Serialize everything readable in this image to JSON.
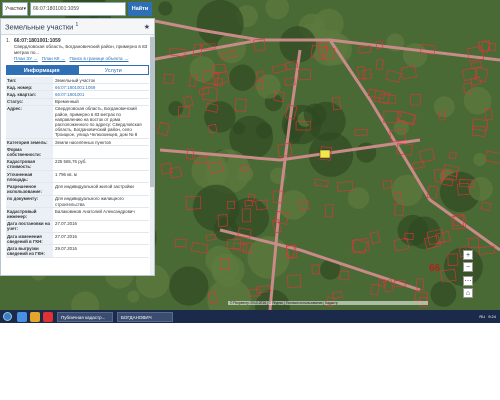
{
  "search": {
    "layer": "Участки",
    "value": "66:07:1801001:1059",
    "button": "Найти"
  },
  "panel": {
    "title": "Земельные участки",
    "title_count": "1",
    "result": {
      "index": "1.",
      "number": "66:07:1801001:1059",
      "address": "Свердловская область, Богдановичский район, примерно в 83 метрах по..."
    },
    "links": [
      "План ЗУ →",
      "План КК →",
      "Поиск в границе объекта →"
    ],
    "tabs": [
      {
        "label": "Информация"
      },
      {
        "label": "Услуги"
      }
    ],
    "props": [
      {
        "k": "Тип:",
        "v": "Земельный участок"
      },
      {
        "k": "Кад. номер:",
        "v": "66:07:1801001:1059"
      },
      {
        "k": "Кад. квартал:",
        "v": "66:07:1801001"
      },
      {
        "k": "Статус:",
        "v": "Временный"
      },
      {
        "k": "Адрес:",
        "v": "Свердловская область, Богдановичский район, примерно в 83 метрах по направлению на восток от дома расположенного по адресу: Свердловская область, Богдановичский район, село Троицкое, улица Челюскинцев, дом № 8"
      },
      {
        "k": "Категория земель:",
        "v": "Земли населённых пунктов"
      },
      {
        "k": "Форма собственности:",
        "v": ""
      },
      {
        "k": "Кадастровая стоимость:",
        "v": "225 565,76 руб."
      },
      {
        "k": "Уточненная площадь:",
        "v": "1 796 кв. м"
      },
      {
        "k": "Разрешенное использование:",
        "v": "Для индивидуальной жилой застройки"
      },
      {
        "k": "по документу:",
        "v": "Для индивидуального жилищного строительства"
      },
      {
        "k": "Кадастровый инженер:",
        "v": "Балаковиков Анатолий Александрович"
      },
      {
        "k": "Дата постановки на учет:",
        "v": "27.07.2016"
      },
      {
        "k": "Дата изменения сведений в ГКН:",
        "v": "27.07.2016"
      },
      {
        "k": "Дата выгрузки сведений из ГКН:",
        "v": "29.07.2016"
      }
    ]
  },
  "map": {
    "zoom_in": "+",
    "zoom_out": "−",
    "more": "⋯",
    "home": "⌂",
    "lot_label": "66",
    "attribution": "© Росреестр 2010-2016 | © Яндекс | Условия использования | Кадастр",
    "colors": {
      "parcel_line": "#e5323a",
      "road": "#c98a8a",
      "accent": "#2f6fb6"
    }
  },
  "taskbar": {
    "tasks": [
      "Публичная кадастр...",
      "БОГДАНОВИЧ"
    ],
    "tray": [
      "RU",
      "9:24"
    ]
  }
}
